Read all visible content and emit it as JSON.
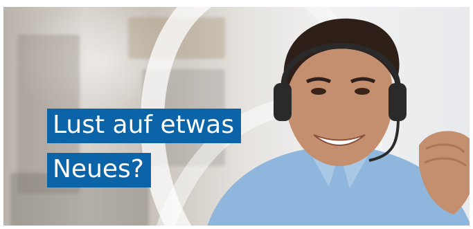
{
  "banner": {
    "headline": {
      "line1": "Lust auf etwas",
      "line2": "Neues?"
    }
  },
  "colors": {
    "headline_background": "#0b64a8",
    "headline_text": "#ffffff",
    "frame": "#ffffff"
  }
}
